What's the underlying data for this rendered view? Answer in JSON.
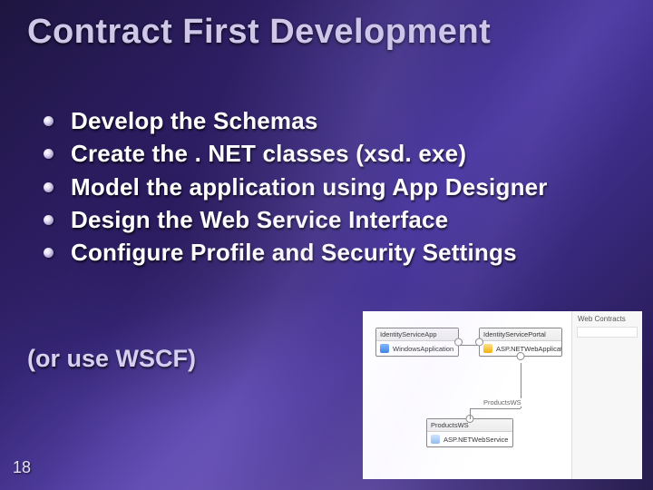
{
  "title": "Contract First Development",
  "bullets": [
    "Develop the Schemas",
    "Create the . NET classes (xsd. exe)",
    "Model the application using App Designer",
    "Design the Web Service Interface",
    "Configure Profile and Security Settings"
  ],
  "subnote": "(or use WSCF)",
  "slide_number": "18",
  "diagram": {
    "side_title": "Web Contracts",
    "nodes": {
      "n1": {
        "header": "IdentityServiceApp",
        "body": "WindowsApplication",
        "icon": "app"
      },
      "n2": {
        "header": "IdentityServicePortal",
        "body": "ASP.NETWebApplication",
        "icon": "iis"
      },
      "n3": {
        "header": "ProductsWS",
        "body": "ASP.NETWebService",
        "icon": "wnd"
      }
    },
    "connector_label": "ProductsWS"
  }
}
